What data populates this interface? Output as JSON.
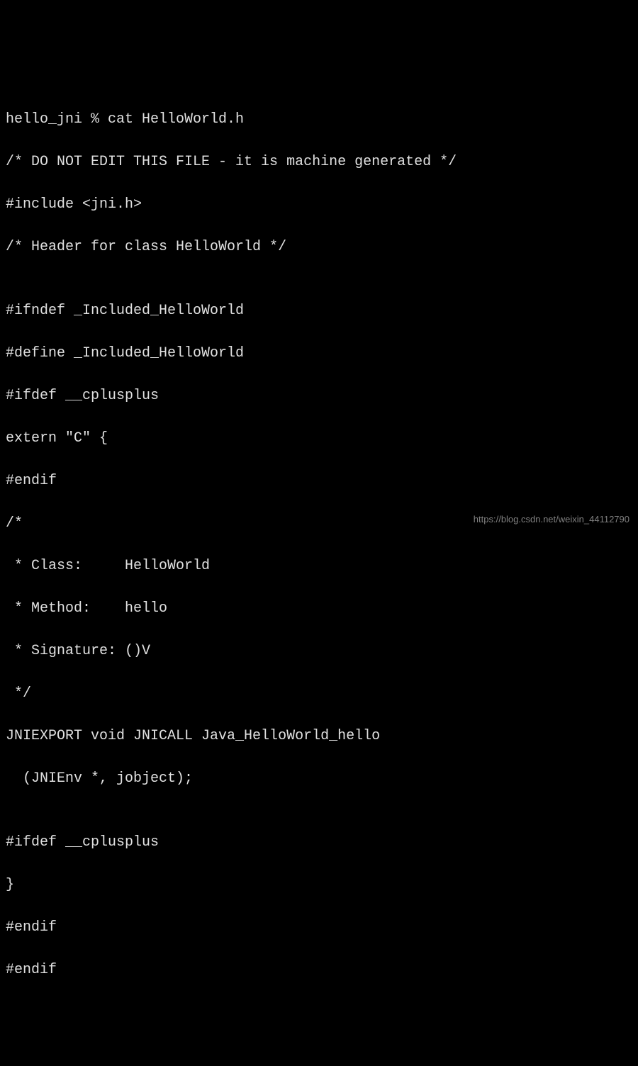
{
  "terminal": {
    "lines": [
      "hello_jni % cat HelloWorld.h",
      "/* DO NOT EDIT THIS FILE - it is machine generated */",
      "#include <jni.h>",
      "/* Header for class HelloWorld */",
      "",
      "#ifndef _Included_HelloWorld",
      "#define _Included_HelloWorld",
      "#ifdef __cplusplus",
      "extern \"C\" {",
      "#endif",
      "/*",
      " * Class:     HelloWorld",
      " * Method:    hello",
      " * Signature: ()V",
      " */",
      "JNIEXPORT void JNICALL Java_HelloWorld_hello",
      "  (JNIEnv *, jobject);",
      "",
      "#ifdef __cplusplus",
      "}",
      "#endif",
      "#endif"
    ]
  },
  "watermark": "https://blog.csdn.net/weixin_44112790"
}
